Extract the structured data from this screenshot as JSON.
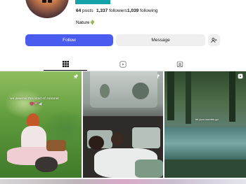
{
  "profile": {
    "stats": {
      "posts_count": "64",
      "posts_label": "posts",
      "followers_count": "1,337",
      "followers_label": "followers",
      "following_count": "1,039",
      "following_label": "following"
    },
    "bio": "Nature🌵",
    "follow_label": "Follow",
    "message_label": "Message"
  },
  "tabs": [
    {
      "icon": "grid-icon",
      "active": true
    },
    {
      "icon": "reels-icon",
      "active": false
    },
    {
      "icon": "tagged-icon",
      "active": false
    }
  ],
  "posts": [
    {
      "caption": "we deserve this kind of summer",
      "emojis": "💗🌷🕊️",
      "pinned": true
    },
    {
      "pinned": true
    },
    {
      "caption": "let your worries go",
      "pinned": true
    }
  ]
}
